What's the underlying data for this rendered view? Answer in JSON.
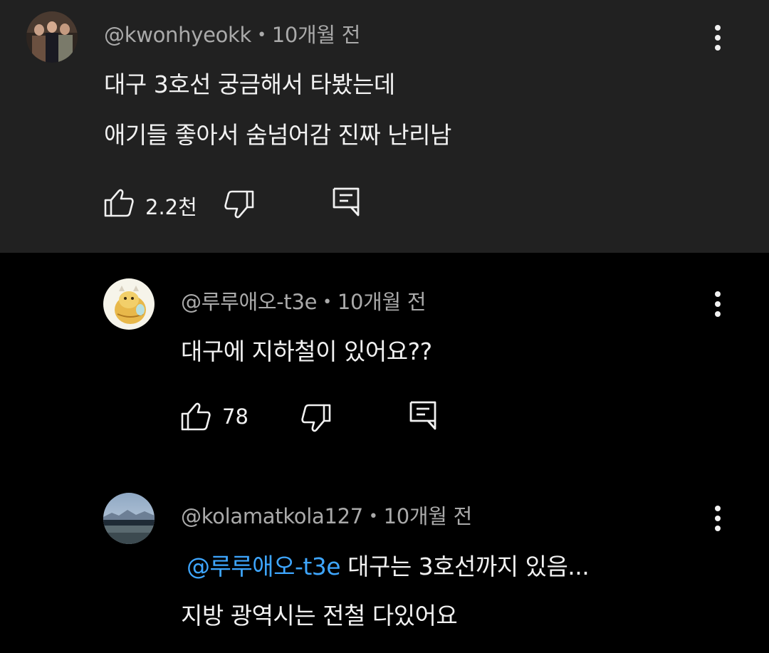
{
  "comments": [
    {
      "author": "@kwonhyeokk",
      "separator": "•",
      "time": "10개월 전",
      "lines": [
        "대구 3호선 궁금해서 타봤는데",
        "애기들 좋아서 숨넘어감 진짜 난리남"
      ],
      "likes": "2.2천"
    },
    {
      "author": "@루루애오-t3e",
      "separator": "•",
      "time": "10개월 전",
      "lines": [
        "대구에 지하철이 있어요??"
      ],
      "likes": "78"
    },
    {
      "author": "@kolamatkola127",
      "separator": "•",
      "time": "10개월 전",
      "mention": "@루루애오-t3e",
      "lines": [
        "대구는 3호선까지 있음...",
        "지방 광역시는 전철 다있어요"
      ]
    }
  ],
  "colors": {
    "highlight_bg": "#212121",
    "background": "#000000",
    "mention": "#3ea6ff",
    "meta": "#aaaaaa"
  },
  "icons": [
    "thumbs-up-icon",
    "thumbs-down-icon",
    "reply-icon",
    "more-vert-icon"
  ]
}
